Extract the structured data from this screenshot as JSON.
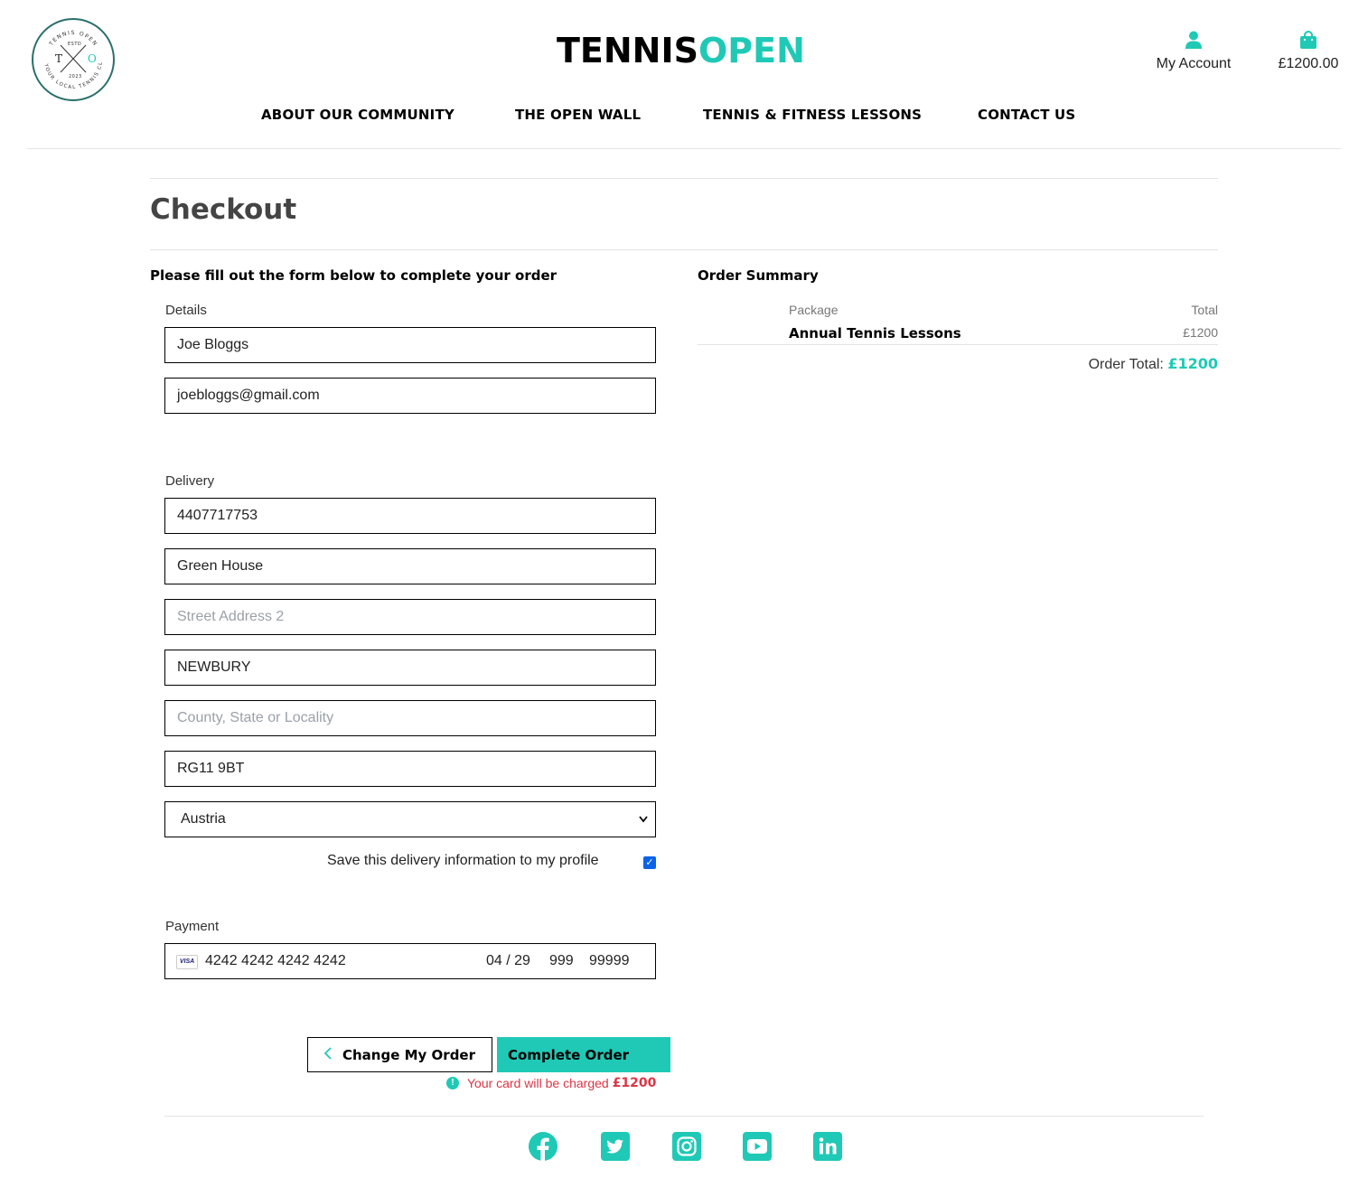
{
  "colors": {
    "accent": "#1fc9b6",
    "error": "#dc3545",
    "checkbox": "#0a63e8"
  },
  "logo": {
    "icon": "tennis-open-badge",
    "arc_top": "TENNIS OPEN",
    "estd": "ESTD",
    "year": "2023",
    "arc_bottom": "YOUR LOCAL TENNIS CLUB",
    "letter_left": "T",
    "letter_right": "O"
  },
  "brand": {
    "part1": "TENNIS",
    "part2": "OPEN"
  },
  "header": {
    "account": {
      "icon": "user-icon",
      "label": "My Account"
    },
    "bag": {
      "icon": "shopping-bag-icon",
      "label": "£1200.00"
    }
  },
  "nav": [
    {
      "label": "ABOUT OUR COMMUNITY"
    },
    {
      "label": "THE OPEN WALL"
    },
    {
      "label": "TENNIS & FITNESS LESSONS"
    },
    {
      "label": "CONTACT US"
    }
  ],
  "page": {
    "title": "Checkout",
    "form_intro": "Please fill out the form below to complete your order"
  },
  "form": {
    "details_label": "Details",
    "full_name": "Joe Bloggs",
    "email": "joebloggs@gmail.com",
    "delivery_label": "Delivery",
    "phone": "4407717753",
    "street1": "Green House",
    "street2_placeholder": "Street Address 2",
    "town": "NEWBURY",
    "county_placeholder": "County, State or Locality",
    "postcode": "RG11 9BT",
    "country": "Austria",
    "save_info_label": "Save this delivery information to my profile",
    "save_info_checked": true,
    "payment_label": "Payment",
    "card": {
      "brand": "VISA",
      "number": "4242 4242 4242 4242",
      "expiry": "04 / 29",
      "cvc": "999",
      "zip": "99999"
    }
  },
  "actions": {
    "back_label": "Change My Order",
    "back_icon": "chevron-left-icon",
    "complete_label": "Complete Order",
    "charge_text": "Your card will be charged",
    "charge_amount": "£1200",
    "charge_icon": "info-circle-icon"
  },
  "order_summary": {
    "title": "Order Summary",
    "col_package": "Package",
    "col_total": "Total",
    "items": [
      {
        "name": "Annual Tennis Lessons",
        "price": "£1200"
      }
    ],
    "total_label": "Order Total:",
    "total_value": "£1200"
  },
  "footer": {
    "social": [
      "facebook-icon",
      "twitter-icon",
      "instagram-icon",
      "youtube-icon",
      "linkedin-icon"
    ]
  }
}
